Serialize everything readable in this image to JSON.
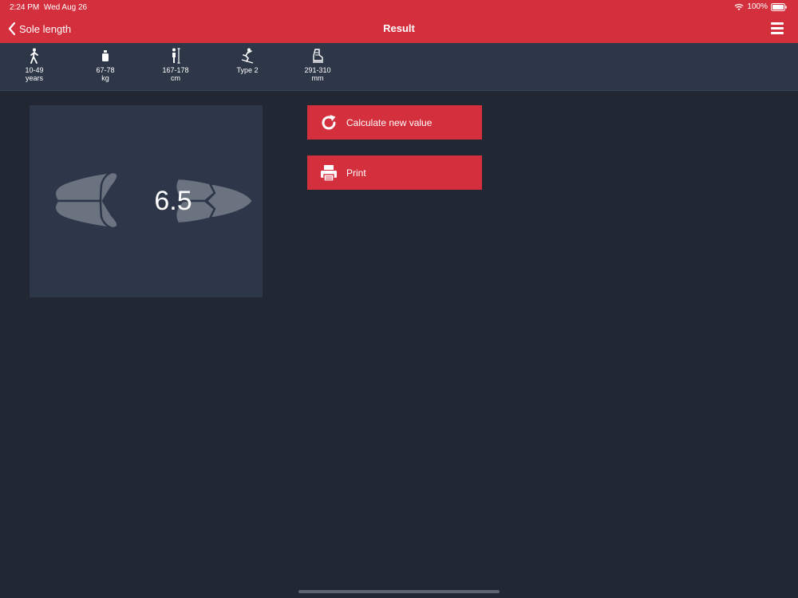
{
  "status": {
    "time": "2:24 PM",
    "date": "Wed Aug 26",
    "battery": "100%"
  },
  "nav": {
    "back_label": "Sole length",
    "title": "Result"
  },
  "info": [
    {
      "icon": "walking-person-icon",
      "line1": "10-49",
      "line2": "years"
    },
    {
      "icon": "weight-icon",
      "line1": "67-78",
      "line2": "kg"
    },
    {
      "icon": "height-icon",
      "line1": "167-178",
      "line2": "cm"
    },
    {
      "icon": "skier-icon",
      "line1": "Type 2",
      "line2": ""
    },
    {
      "icon": "ski-boot-icon",
      "line1": "291-310",
      "line2": "mm"
    }
  ],
  "result": {
    "value": "6.5"
  },
  "actions": {
    "calculate_label": "Calculate new value",
    "print_label": "Print"
  },
  "colors": {
    "accent": "#d32f3d",
    "background": "#222833",
    "panel": "#2e3749"
  }
}
